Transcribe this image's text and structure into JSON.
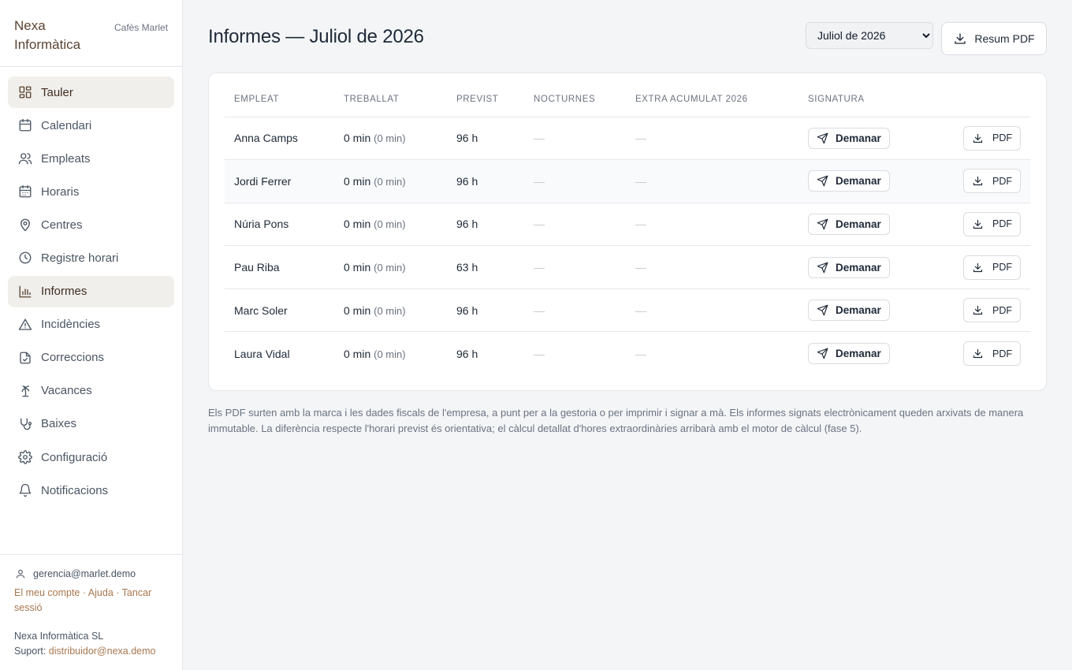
{
  "brand": {
    "name": "Nexa Informàtica",
    "client": "Cafès Marlet"
  },
  "nav": [
    {
      "key": "tauler",
      "label": "Tauler",
      "icon": "dashboard-icon",
      "active": true
    },
    {
      "key": "calendari",
      "label": "Calendari",
      "icon": "calendar-icon",
      "active": false
    },
    {
      "key": "empleats",
      "label": "Empleats",
      "icon": "users-icon",
      "active": false
    },
    {
      "key": "horaris",
      "label": "Horaris",
      "icon": "schedule-icon",
      "active": false
    },
    {
      "key": "centres",
      "label": "Centres",
      "icon": "map-pin-icon",
      "active": false
    },
    {
      "key": "registre",
      "label": "Registre horari",
      "icon": "clock-icon",
      "active": false
    },
    {
      "key": "informes",
      "label": "Informes",
      "icon": "bar-chart-icon",
      "active": true
    },
    {
      "key": "incidencies",
      "label": "Incidències",
      "icon": "warning-icon",
      "active": false
    },
    {
      "key": "correccions",
      "label": "Correccions",
      "icon": "file-check-icon",
      "active": false
    },
    {
      "key": "vacances",
      "label": "Vacances",
      "icon": "palm-tree-icon",
      "active": false
    },
    {
      "key": "baixes",
      "label": "Baixes",
      "icon": "stethoscope-icon",
      "active": false
    },
    {
      "key": "configuracio",
      "label": "Configuració",
      "icon": "gear-icon",
      "active": false
    },
    {
      "key": "notificacions",
      "label": "Notificacions",
      "icon": "bell-icon",
      "active": false
    }
  ],
  "footer": {
    "email": "gerencia@marlet.demo",
    "account": "El meu compte",
    "help": "Ajuda",
    "logout": "Tancar sessió",
    "sep": " · ",
    "company": "Nexa Informàtica SL",
    "support_label": "Suport:",
    "support_email": "distribuidor@nexa.demo"
  },
  "header": {
    "title": "Informes — Juliol de 2026",
    "month_selected": "Juliol de 2026",
    "summary_pdf": "Resum PDF"
  },
  "table": {
    "columns": [
      "Empleat",
      "Treballat",
      "Previst",
      "Nocturnes",
      "Extra acumulat 2026",
      "Signatura"
    ],
    "rows": [
      {
        "name": "Anna Camps",
        "worked": "0 min",
        "worked_sub": "(0 min)",
        "planned": "96 h",
        "night": "—",
        "extra": "—",
        "ask": "Demanar",
        "pdf": "PDF"
      },
      {
        "name": "Jordi Ferrer",
        "worked": "0 min",
        "worked_sub": "(0 min)",
        "planned": "96 h",
        "night": "—",
        "extra": "—",
        "ask": "Demanar",
        "pdf": "PDF"
      },
      {
        "name": "Núria Pons",
        "worked": "0 min",
        "worked_sub": "(0 min)",
        "planned": "96 h",
        "night": "—",
        "extra": "—",
        "ask": "Demanar",
        "pdf": "PDF"
      },
      {
        "name": "Pau Riba",
        "worked": "0 min",
        "worked_sub": "(0 min)",
        "planned": "63 h",
        "night": "—",
        "extra": "—",
        "ask": "Demanar",
        "pdf": "PDF"
      },
      {
        "name": "Marc Soler",
        "worked": "0 min",
        "worked_sub": "(0 min)",
        "planned": "96 h",
        "night": "—",
        "extra": "—",
        "ask": "Demanar",
        "pdf": "PDF"
      },
      {
        "name": "Laura Vidal",
        "worked": "0 min",
        "worked_sub": "(0 min)",
        "planned": "96 h",
        "night": "—",
        "extra": "—",
        "ask": "Demanar",
        "pdf": "PDF"
      }
    ]
  },
  "note": "Els PDF surten amb la marca i les dades fiscals de l'empresa, a punt per a la gestoria o per imprimir i signar a mà. Els informes signats electrònicament queden arxivats de manera immutable. La diferència respecte l'horari previst és orientativa; el càlcul detallat d'hores extraordinàries arribarà amb el motor de càlcul (fase 5).",
  "colors": {
    "brand": "#5a4332",
    "link": "#a8774f",
    "active_bg": "#f1efec"
  }
}
